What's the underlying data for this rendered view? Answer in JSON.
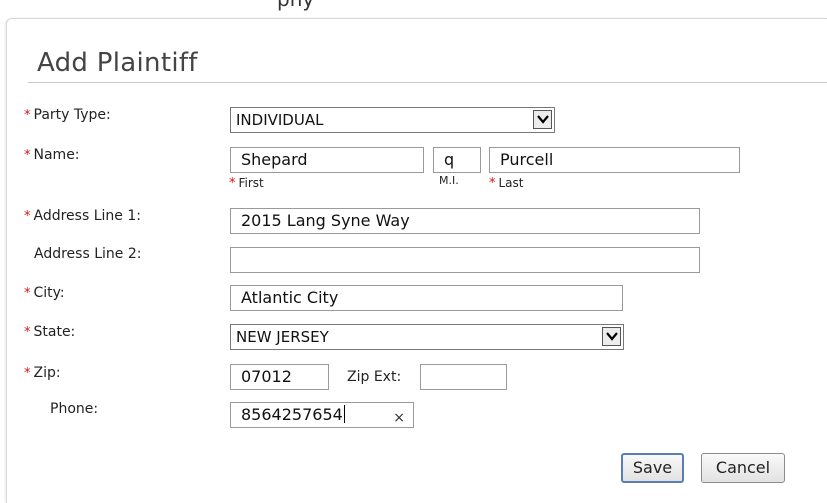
{
  "header": {
    "clipped_text": "pny"
  },
  "dialog": {
    "title": "Add Plaintiff",
    "required_mark": "*",
    "fields": {
      "party_type": {
        "label": "Party Type:",
        "value": "INDIVIDUAL"
      },
      "name": {
        "label": "Name:",
        "first": "Shepard",
        "mi": "q",
        "last": "Purcell",
        "first_caption": "First",
        "mi_caption": "M.I.",
        "last_caption": "Last"
      },
      "address1": {
        "label": "Address Line 1:",
        "value": "2015 Lang Syne Way"
      },
      "address2": {
        "label": "Address Line 2:",
        "value": ""
      },
      "city": {
        "label": "City:",
        "value": "Atlantic City"
      },
      "state": {
        "label": "State:",
        "value": "NEW JERSEY"
      },
      "zip": {
        "label": "Zip:",
        "value": "07012"
      },
      "zip_ext": {
        "label": "Zip Ext:",
        "value": ""
      },
      "phone": {
        "label": "Phone:",
        "value": "8564257654",
        "clear_glyph": "×"
      }
    },
    "buttons": {
      "save": "Save",
      "cancel": "Cancel"
    }
  },
  "colors": {
    "required": "#dd1111",
    "save_border": "#5a7fb8"
  }
}
